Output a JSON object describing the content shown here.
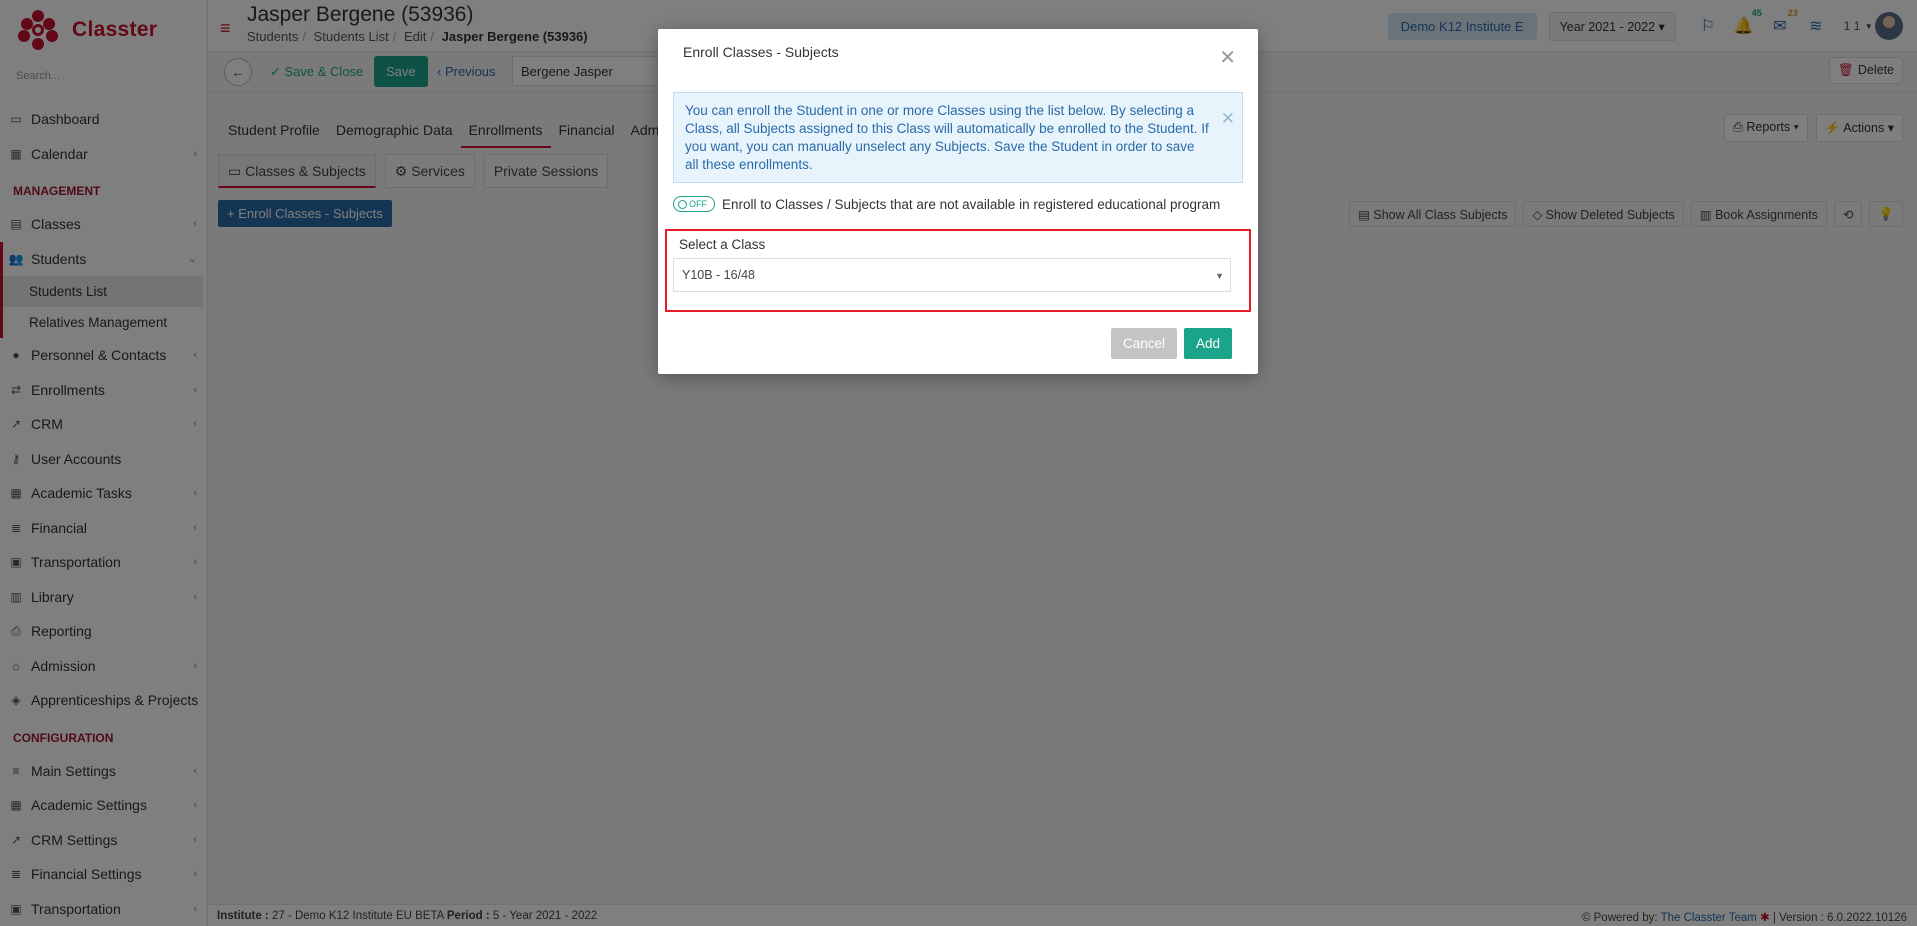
{
  "app": {
    "logo_text": "Classter",
    "brand_color": "#c8102e",
    "accent_color": "#1aa489",
    "link_color": "#2b6aa8"
  },
  "sidebar": {
    "search_placeholder": "Search...",
    "items_top": [
      {
        "label": "Dashboard",
        "icon": "laptop-icon"
      },
      {
        "label": "Calendar",
        "icon": "calendar-icon"
      }
    ],
    "section_management": "MANAGEMENT",
    "management": {
      "classes": "Classes",
      "students": "Students",
      "students_list": "Students List",
      "relatives": "Relatives Management",
      "rest": [
        {
          "label": "Personnel & Contacts",
          "icon": "users-icon"
        },
        {
          "label": "Enrollments",
          "icon": "exchange-icon"
        },
        {
          "label": "CRM",
          "icon": "crm-icon"
        },
        {
          "label": "User Accounts",
          "icon": "key-icon"
        },
        {
          "label": "Academic Tasks",
          "icon": "grid-icon"
        },
        {
          "label": "Financial",
          "icon": "coins-icon"
        },
        {
          "label": "Transportation",
          "icon": "bus-icon"
        },
        {
          "label": "Library",
          "icon": "books-icon"
        },
        {
          "label": "Reporting",
          "icon": "printer-icon"
        },
        {
          "label": "Admission",
          "icon": "bank-icon"
        },
        {
          "label": "Apprenticeships & Projects",
          "icon": "cube-icon"
        }
      ]
    },
    "section_configuration": "CONFIGURATION",
    "configuration": [
      {
        "label": "Main Settings",
        "icon": "sliders-icon"
      },
      {
        "label": "Academic Settings",
        "icon": "grid-icon"
      },
      {
        "label": "CRM Settings",
        "icon": "crm-icon"
      },
      {
        "label": "Financial Settings",
        "icon": "coins-icon"
      },
      {
        "label": "Transportation",
        "icon": "bus-icon"
      }
    ]
  },
  "header": {
    "title": "Jasper Bergene (53936)",
    "breadcrumb": [
      "Students",
      "Students List",
      "Edit",
      "Jasper Bergene (53936)"
    ],
    "institute": "Demo K12 Institute E",
    "year": "Year 2021 - 2022",
    "notifications_count": "45",
    "messages_count": "23",
    "user_count": "1 1"
  },
  "actionbar": {
    "save_close": "Save & Close",
    "save": "Save",
    "previous": "Previous",
    "student_name": "Bergene Jasper",
    "delete": "Delete"
  },
  "tabs": [
    "Student Profile",
    "Demographic Data",
    "Enrollments",
    "Financial",
    "Admis"
  ],
  "reports": "Reports",
  "actions": "Actions",
  "subtabs": [
    "Classes & Subjects",
    "Services",
    "Private Sessions"
  ],
  "enroll_button": "Enroll Classes - Subjects",
  "tools": [
    "Show All Class Subjects",
    "Show Deleted Subjects",
    "Book Assignments"
  ],
  "footer": {
    "institute_label": "Institute :",
    "institute_value": "27 - Demo K12 Institute EU BETA",
    "period_label": "Period :",
    "period_value": "5 - Year 2021 - 2022",
    "powered": "Powered by:",
    "team": "The Classter Team",
    "version": "| Version : 6.0.2022.10126"
  },
  "modal": {
    "title": "Enroll Classes - Subjects",
    "info": "You can enroll the Student in one or more Classes using the list below. By selecting a Class, all Subjects assigned to this Class will automatically be enrolled to the Student. If you want, you can manually unselect any Subjects. Save the Student in order to save all these enrollments.",
    "toggle_state": "OFF",
    "toggle_label": "Enroll to Classes / Subjects that are not available in registered educational program",
    "select_label": "Select a Class",
    "select_value": "Y10B - 16/48",
    "cancel": "Cancel",
    "add": "Add"
  }
}
